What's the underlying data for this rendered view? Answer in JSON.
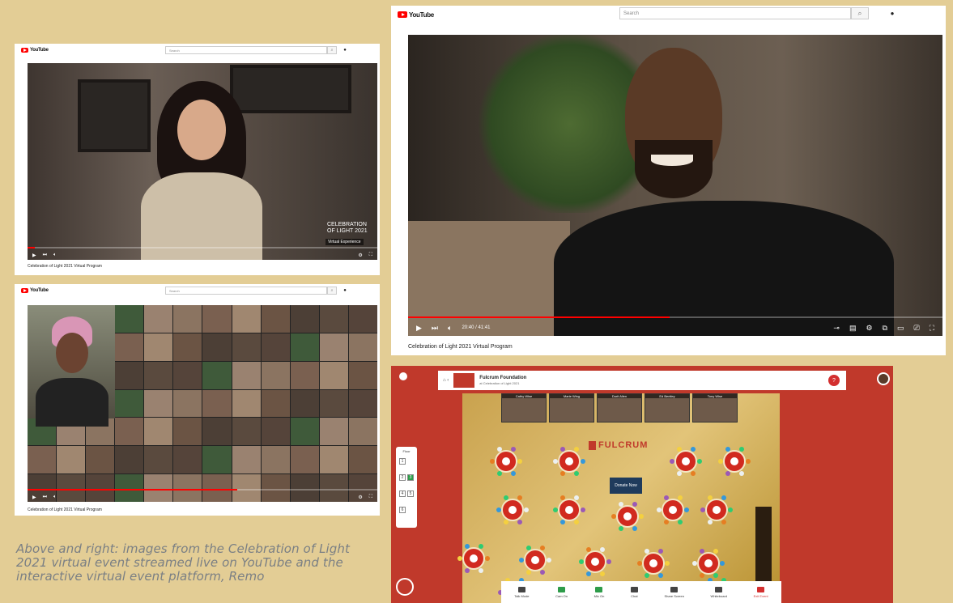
{
  "colors": {
    "page_bg": "#e3cd95",
    "youtube_red": "#ff0000",
    "remo_red": "#c0392b",
    "caption": "#7a7f84"
  },
  "shot1": {
    "logo": "YouTube",
    "search_placeholder": "Search",
    "search_icon": "search-icon",
    "mic_icon": "mic-icon",
    "video_title": "Celebration of Light 2021 Virtual Program",
    "watermark": "CELEBRATION OF LIGHT 2021",
    "watermark_badge": "Virtual Experience",
    "progress": 0.02
  },
  "shot2": {
    "logo": "YouTube",
    "search_placeholder": "Search",
    "video_title": "Celebration of Light 2021 Virtual Program",
    "progress": 0.6
  },
  "shot3": {
    "logo": "YouTube",
    "search_placeholder": "Search",
    "time": "20:40 / 41:41",
    "video_title": "Celebration of Light 2021 Virtual Program",
    "progress": 0.49
  },
  "remo": {
    "org_name": "Fulcrum Foundation",
    "event_name": "at Celebration of Light 2021",
    "brand": "FULCRUM",
    "donate_label": "Donate Now",
    "floor_label": "Floor",
    "cam_names": [
      "Cathy Wise",
      "Marie Wing",
      "Dorit Allen",
      "Ed Bentley",
      "Tony Wise"
    ],
    "toolbar": [
      "Talk Mode",
      "Cam On",
      "Mic On",
      "Chat",
      "Share Screen",
      "Whiteboard",
      "Exit Event"
    ]
  },
  "caption": "Above and right: images from the Celebration of Light 2021 virtual event streamed live on YouTube and the interactive virtual event platform, Remo"
}
